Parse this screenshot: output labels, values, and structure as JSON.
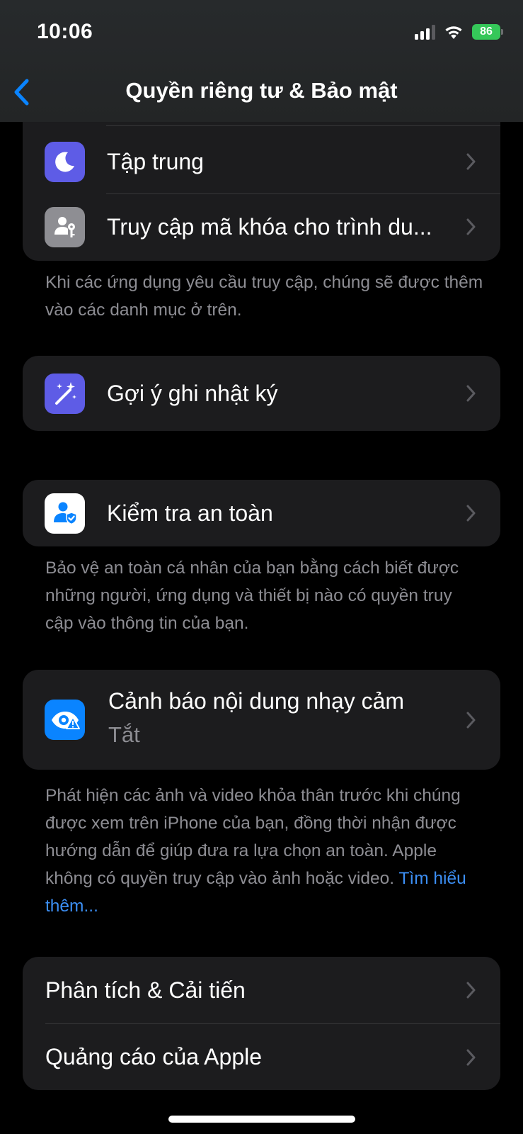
{
  "status": {
    "time": "10:06",
    "battery": "86"
  },
  "nav": {
    "title": "Quyền riêng tư & Bảo mật"
  },
  "group1": {
    "focus_label": "Tập trung",
    "passkey_label": "Truy cập mã khóa cho trình du..."
  },
  "note1": "Khi các ứng dụng yêu cầu truy cập, chúng sẽ được thêm vào các danh mục ở trên.",
  "journal": {
    "label": "Gợi ý ghi nhật ký"
  },
  "safety": {
    "label": "Kiểm tra an toàn"
  },
  "note2": "Bảo vệ an toàn cá nhân của bạn bằng cách biết được những người, ứng dụng và thiết bị nào có quyền truy cập vào thông tin của bạn.",
  "sensitive": {
    "label": "Cảnh báo nội dung nhạy cảm",
    "value": "Tắt"
  },
  "note3": {
    "text": "Phát hiện các ảnh và video khỏa thân trước khi chúng được xem trên iPhone của bạn, đồng thời nhận được hướng dẫn để giúp đưa ra lựa chọn an toàn. Apple không có quyền truy cập vào ảnh hoặc video.",
    "link": "Tìm hiểu thêm..."
  },
  "group5": {
    "analytics_label": "Phân tích & Cải tiến",
    "ads_label": "Quảng cáo của Apple"
  },
  "colors": {
    "focus_icon": "#5e5ce6",
    "passkey_icon": "#8e8e93",
    "journal_icon": "#5e5ce6",
    "safety_icon": "#ffffff",
    "sensitive_icon": "#0a84ff",
    "link": "#3c8ff5"
  }
}
